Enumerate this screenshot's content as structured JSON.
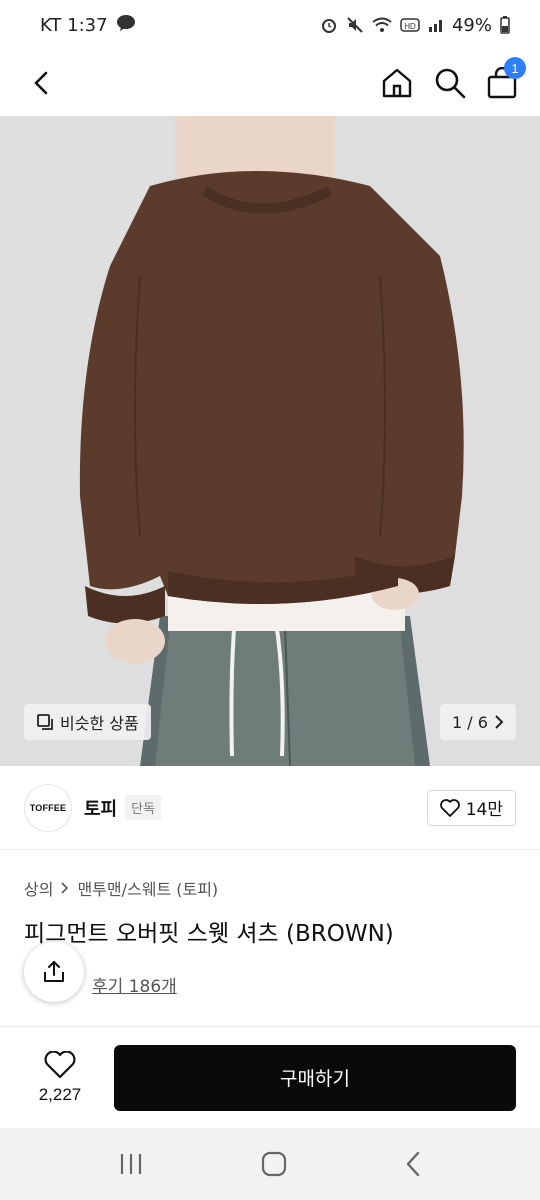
{
  "status_bar": {
    "carrier_time": "KT 1:37",
    "battery": "49%"
  },
  "header": {
    "cart_count": "1"
  },
  "gallery": {
    "similar_label": "비슷한 상품",
    "page_indicator": "1 / 6"
  },
  "brand": {
    "logo_text": "TOFFEE",
    "name": "토피",
    "badge": "단독",
    "likes": "14만"
  },
  "product": {
    "breadcrumb": [
      "상의",
      "맨투맨/스웨트 (토피)"
    ],
    "title": "피그먼트 오버핏 스웻 셔츠 (BROWN)",
    "review_label": "후기 186개"
  },
  "bottom_bar": {
    "wish_count": "2,227",
    "buy_label": "구매하기"
  },
  "colors": {
    "accent": "#2d7ff9",
    "buy_button": "#0a0a0a",
    "sweatshirt": "#5a3b2c",
    "background_photo": "#dedede"
  },
  "icons": [
    "back-icon",
    "home-icon",
    "search-icon",
    "cart-icon",
    "copy-icon",
    "chevron-right-icon",
    "heart-icon",
    "share-icon",
    "recent-apps-icon",
    "home-button-icon",
    "back-nav-icon"
  ]
}
